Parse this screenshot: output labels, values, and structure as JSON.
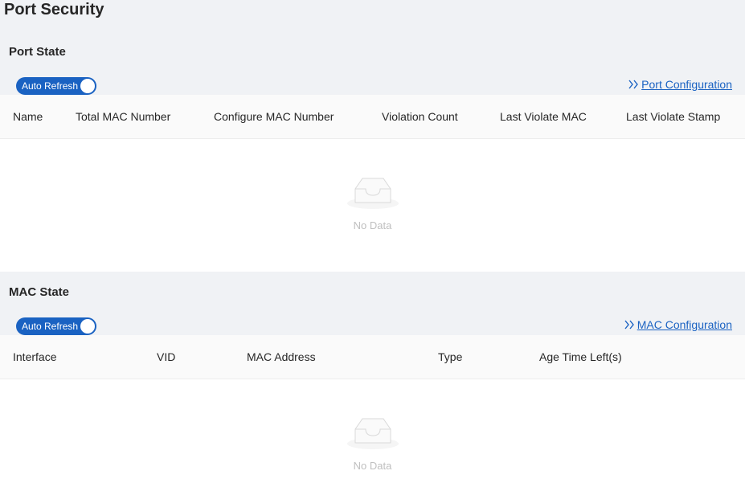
{
  "page": {
    "title": "Port Security"
  },
  "port_state": {
    "title": "Port State",
    "auto_refresh_label": "Auto Refresh",
    "auto_refresh_on": true,
    "config_link": "Port Configuration",
    "columns": [
      "Name",
      "Total MAC Number",
      "Configure MAC Number",
      "Violation Count",
      "Last Violate MAC",
      "Last Violate Stamp"
    ],
    "rows": [],
    "empty_text": "No Data"
  },
  "mac_state": {
    "title": "MAC State",
    "auto_refresh_label": "Auto Refresh",
    "auto_refresh_on": true,
    "config_link": "MAC Configuration",
    "columns": [
      "Interface",
      "VID",
      "MAC Address",
      "Type",
      "Age Time Left(s)"
    ],
    "rows": [],
    "empty_text": "No Data"
  },
  "icons": {
    "config_link": "double-chevron-right-icon",
    "empty": "empty-inbox-icon"
  },
  "colors": {
    "accent": "#1a62c2",
    "background": "#f0f2f5",
    "table_header": "#fafafa",
    "muted_text": "#bfbfbf"
  }
}
